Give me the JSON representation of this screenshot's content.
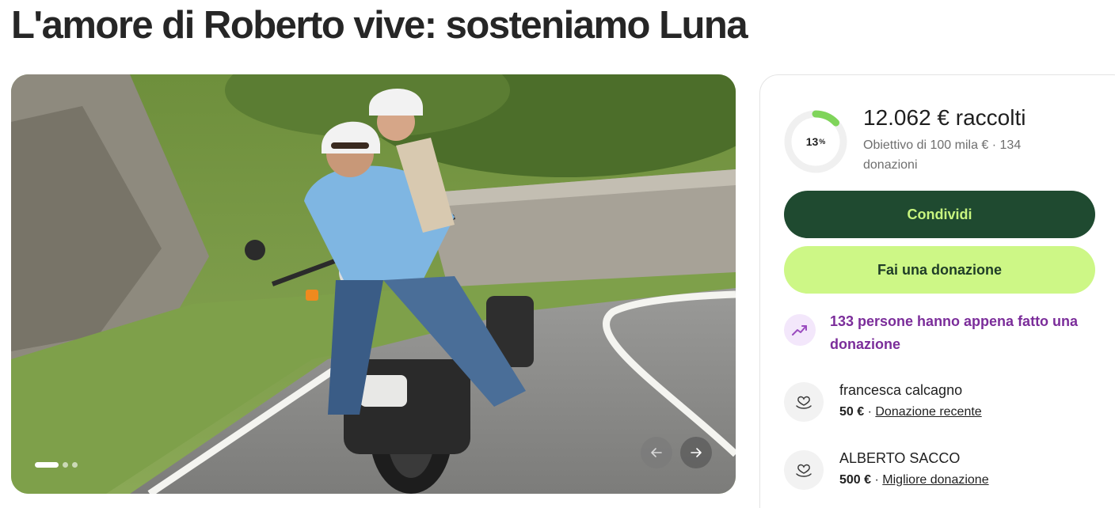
{
  "page": {
    "title": "L'amore di Roberto vive: sosteniamo Luna"
  },
  "carousel": {
    "prev_icon": "arrow-left-icon",
    "next_icon": "arrow-right-icon",
    "slide_count": 3,
    "active_slide": 1
  },
  "fundraiser": {
    "progress_value": "13",
    "progress_unit": "%",
    "progress_fraction": 0.13,
    "raised": "12.062 € raccolti",
    "goal_line": "Obiettivo di 100 mila € · 134 donazioni",
    "share_label": "Condividi",
    "donate_label": "Fai una donazione",
    "trending_text": "133 persone hanno appena fatto una donazione",
    "colors": {
      "progress": "#7fd45a",
      "share_bg": "#1f4a30",
      "share_text": "#c8f57f",
      "donate_bg": "#cdf786",
      "trending": "#7b2d9a"
    }
  },
  "donations": [
    {
      "name": "francesca calcagno",
      "amount": "50 €",
      "separator": "·",
      "tag": "Donazione recente"
    },
    {
      "name": "ALBERTO SACCO",
      "amount": "500 €",
      "separator": "·",
      "tag": "Migliore donazione"
    }
  ]
}
